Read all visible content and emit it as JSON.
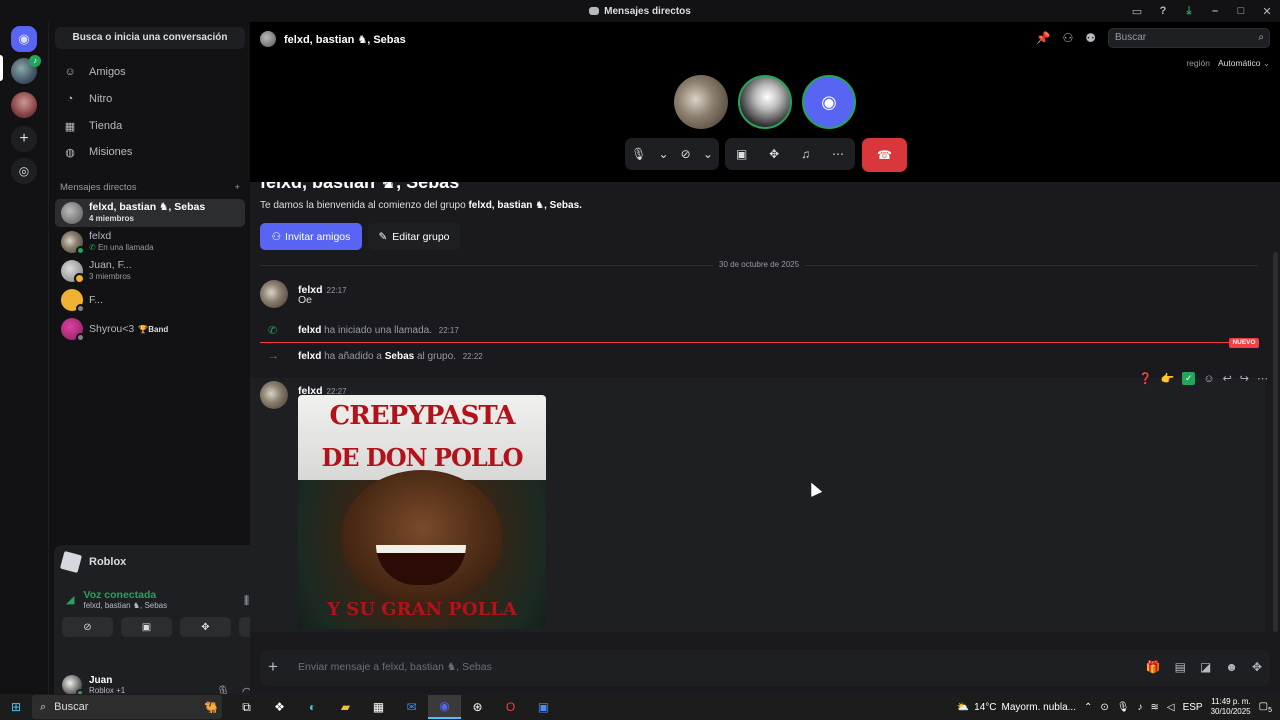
{
  "window": {
    "title": "Mensajes directos"
  },
  "sidebar": {
    "search_label": "Busca o inicia una conversación",
    "nav": [
      {
        "icon": "friends-icon",
        "label": "Amigos"
      },
      {
        "icon": "nitro-icon",
        "label": "Nitro"
      },
      {
        "icon": "shop-icon",
        "label": "Tienda"
      },
      {
        "icon": "quests-icon",
        "label": "Misiones"
      }
    ],
    "dm_header": "Mensajes directos",
    "dms": [
      {
        "name": "felxd, bastian ♞, Sebas",
        "sub": "4 miembros",
        "selected": true
      },
      {
        "name": "felxd",
        "sub": "En una llamada",
        "selected": false
      },
      {
        "name": "Juan, F...",
        "sub": "3 miembros",
        "selected": false
      },
      {
        "name": "F...",
        "sub": "",
        "selected": false
      },
      {
        "name": "Shyrou<3",
        "sub": "",
        "badge": "Band",
        "selected": false
      }
    ]
  },
  "voice_panel": {
    "activity": "Roblox",
    "status": "Voz conectada",
    "channel": "felxd, bastian ♞, Sebas",
    "user_name": "Juan",
    "user_status": "Roblox +1"
  },
  "header": {
    "channel_title": "felxd, bastian ♞, Sebas",
    "search_placeholder": "Buscar",
    "region_label": "región",
    "region_value": "Automático"
  },
  "chat": {
    "welcome_title": "felxd, bastian ♞, Sebas",
    "welcome_prefix": "Te damos la bienvenida al comienzo del grupo",
    "welcome_group": "felxd, bastian ♞, Sebas.",
    "invite_label": "Invitar amigos",
    "edit_label": "Editar grupo",
    "date_divider": "30 de octubre de 2025",
    "new_badge": "NUEVO",
    "messages": [
      {
        "author": "felxd",
        "time": "22:17",
        "text": "Oe"
      },
      {
        "author": "felxd",
        "time": "22:27",
        "text": ""
      }
    ],
    "system": [
      {
        "author": "felxd",
        "text": "ha iniciado una llamada.",
        "time": "22:17"
      },
      {
        "author": "felxd",
        "text": "ha añadido a",
        "target": "Sebas",
        "suffix": "al grupo.",
        "time": "22:22"
      }
    ],
    "meme_text": [
      "CREPYPASTA",
      "DE DON POLLO",
      "Y SU GRAN POLLA"
    ],
    "composer_placeholder": "Enviar mensaje a felxd, bastian ♞, Sebas"
  },
  "taskbar": {
    "search": "Buscar",
    "weather_temp": "14°C",
    "weather_desc": "Mayorm. nubla...",
    "lang": "ESP",
    "time": "11:49 p. m.",
    "date": "30/10/2025",
    "notif_count": "5"
  },
  "colors": {
    "accent": "#5865f2",
    "green": "#23a55a",
    "red": "#da373c"
  }
}
